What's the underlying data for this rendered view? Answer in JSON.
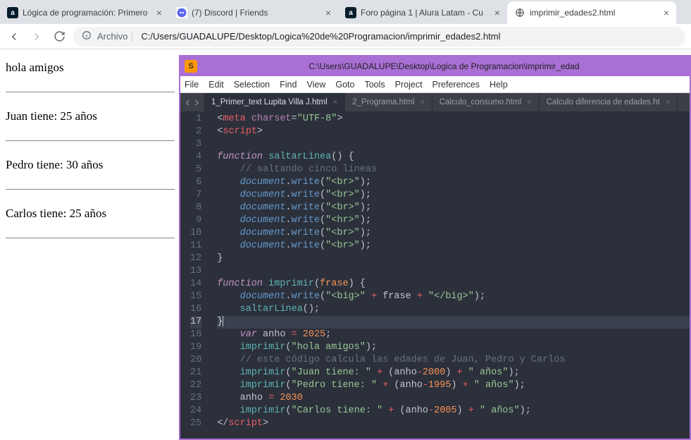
{
  "browser": {
    "tabs": [
      {
        "title": "Lógica de programación: Primero",
        "favicon": "a"
      },
      {
        "title": "(7) Discord | Friends",
        "favicon": "discord"
      },
      {
        "title": "Foro página 1 | Alura Latam - Cu",
        "favicon": "a"
      },
      {
        "title": "imprimir_edades2.html",
        "favicon": "file",
        "active": true
      }
    ],
    "omnibox": {
      "prefix": "Archivo",
      "url": "C:/Users/GUADALUPE/Desktop/Logica%20de%20Programacion/imprimir_edades2.html"
    },
    "nav": {
      "back": "←",
      "forward": "→",
      "reload": "↻"
    }
  },
  "page": {
    "lines": [
      "hola amigos",
      "Juan tiene: 25 años",
      "Pedro tiene: 30 años",
      "Carlos tiene: 25 años"
    ]
  },
  "sublime": {
    "titlebar": "C:\\Users\\GUADALUPE\\Desktop\\Logica de Programacion\\imprimir_edad",
    "menu": [
      "File",
      "Edit",
      "Selection",
      "Find",
      "View",
      "Goto",
      "Tools",
      "Project",
      "Preferences",
      "Help"
    ],
    "tabs": [
      {
        "label": "1_Primer_text Lupita Villa J.html",
        "active": true
      },
      {
        "label": "2_Programa.html"
      },
      {
        "label": "Calculo_consumo.html"
      },
      {
        "label": "Calculo diferencia de edades.ht"
      }
    ],
    "active_line": 17,
    "code": [
      {
        "n": 1,
        "html": "<span class='c-punc'>&lt;</span><span class='c-tag'>meta</span> <span class='c-attr'>charset</span><span class='c-punc'>=</span><span class='c-str'>\"UTF-8\"</span><span class='c-punc'>&gt;</span>"
      },
      {
        "n": 2,
        "html": "<span class='c-punc'>&lt;</span><span class='c-tag'>script</span><span class='c-punc'>&gt;</span>"
      },
      {
        "n": 3,
        "html": ""
      },
      {
        "n": 4,
        "html": "<span class='c-kw'>function</span> <span class='c-fn'>saltarLinea</span><span class='c-punc'>() {</span>"
      },
      {
        "n": 5,
        "html": "    <span class='c-cmt'>// saltando cinco lineas</span>"
      },
      {
        "n": 6,
        "html": "    <span class='c-obj'>document</span><span class='c-punc'>.</span><span class='c-call'>write</span><span class='c-punc'>(</span><span class='c-str'>\"&lt;br&gt;\"</span><span class='c-punc'>);</span>"
      },
      {
        "n": 7,
        "html": "    <span class='c-obj'>document</span><span class='c-punc'>.</span><span class='c-call'>write</span><span class='c-punc'>(</span><span class='c-str'>\"&lt;br&gt;\"</span><span class='c-punc'>);</span>"
      },
      {
        "n": 8,
        "html": "    <span class='c-obj'>document</span><span class='c-punc'>.</span><span class='c-call'>write</span><span class='c-punc'>(</span><span class='c-str'>\"&lt;br&gt;\"</span><span class='c-punc'>);</span>"
      },
      {
        "n": 9,
        "html": "    <span class='c-obj'>document</span><span class='c-punc'>.</span><span class='c-call'>write</span><span class='c-punc'>(</span><span class='c-str'>\"&lt;hr&gt;\"</span><span class='c-punc'>);</span>"
      },
      {
        "n": 10,
        "html": "    <span class='c-obj'>document</span><span class='c-punc'>.</span><span class='c-call'>write</span><span class='c-punc'>(</span><span class='c-str'>\"&lt;br&gt;\"</span><span class='c-punc'>);</span>"
      },
      {
        "n": 11,
        "html": "    <span class='c-obj'>document</span><span class='c-punc'>.</span><span class='c-call'>write</span><span class='c-punc'>(</span><span class='c-str'>\"&lt;br&gt;\"</span><span class='c-punc'>);</span>"
      },
      {
        "n": 12,
        "html": "<span class='c-punc'>}</span>"
      },
      {
        "n": 13,
        "html": ""
      },
      {
        "n": 14,
        "html": "<span class='c-kw'>function</span> <span class='c-fn'>imprimir</span><span class='c-punc'>(</span><span class='c-param'>frase</span><span class='c-punc'>) {</span>"
      },
      {
        "n": 15,
        "html": "    <span class='c-obj'>document</span><span class='c-punc'>.</span><span class='c-call'>write</span><span class='c-punc'>(</span><span class='c-str'>\"&lt;big&gt;\"</span> <span class='c-tag'>+</span> frase <span class='c-tag'>+</span> <span class='c-str'>\"&lt;/big&gt;\"</span><span class='c-punc'>);</span>"
      },
      {
        "n": 16,
        "html": "    <span class='c-fn'>saltarLinea</span><span class='c-punc'>();</span>"
      },
      {
        "n": 17,
        "html": "<span class='c-br'>}</span><span class='cursor-line'></span>"
      },
      {
        "n": 18,
        "html": "    <span class='c-kw'>var</span> anho <span class='c-tag'>=</span> <span class='c-num'>2025</span><span class='c-punc'>;</span>"
      },
      {
        "n": 19,
        "html": "    <span class='c-fn'>imprimir</span><span class='c-punc'>(</span><span class='c-str'>\"hola amigos\"</span><span class='c-punc'>);</span>"
      },
      {
        "n": 20,
        "html": "    <span class='c-cmt'>// este código calcula las edades de Juan, Pedro y Carlos</span>"
      },
      {
        "n": 21,
        "html": "    <span class='c-fn'>imprimir</span><span class='c-punc'>(</span><span class='c-str'>\"Juan tiene: \"</span> <span class='c-tag'>+</span> <span class='c-punc'>(</span>anho<span class='c-tag'>-</span><span class='c-num'>2000</span><span class='c-punc'>)</span> <span class='c-tag'>+</span> <span class='c-str'>\" años\"</span><span class='c-punc'>);</span>"
      },
      {
        "n": 22,
        "html": "    <span class='c-fn'>imprimir</span><span class='c-punc'>(</span><span class='c-str'>\"Pedro tiene: \"</span> <span class='c-tag'>+</span> <span class='c-punc'>(</span>anho<span class='c-tag'>-</span><span class='c-num'>1995</span><span class='c-punc'>)</span> <span class='c-tag'>+</span> <span class='c-str'>\" años\"</span><span class='c-punc'>);</span>"
      },
      {
        "n": 23,
        "html": "    anho <span class='c-tag'>=</span> <span class='c-num'>2030</span>"
      },
      {
        "n": 24,
        "html": "    <span class='c-fn'>imprimir</span><span class='c-punc'>(</span><span class='c-str'>\"Carlos tiene: \"</span> <span class='c-tag'>+</span> <span class='c-punc'>(</span>anho<span class='c-tag'>-</span><span class='c-num'>2005</span><span class='c-punc'>)</span> <span class='c-tag'>+</span> <span class='c-str'>\" años\"</span><span class='c-punc'>);</span>"
      },
      {
        "n": 25,
        "html": "<span class='c-punc'>&lt;/</span><span class='c-tag'>script</span><span class='c-punc'>&gt;</span>"
      }
    ]
  }
}
